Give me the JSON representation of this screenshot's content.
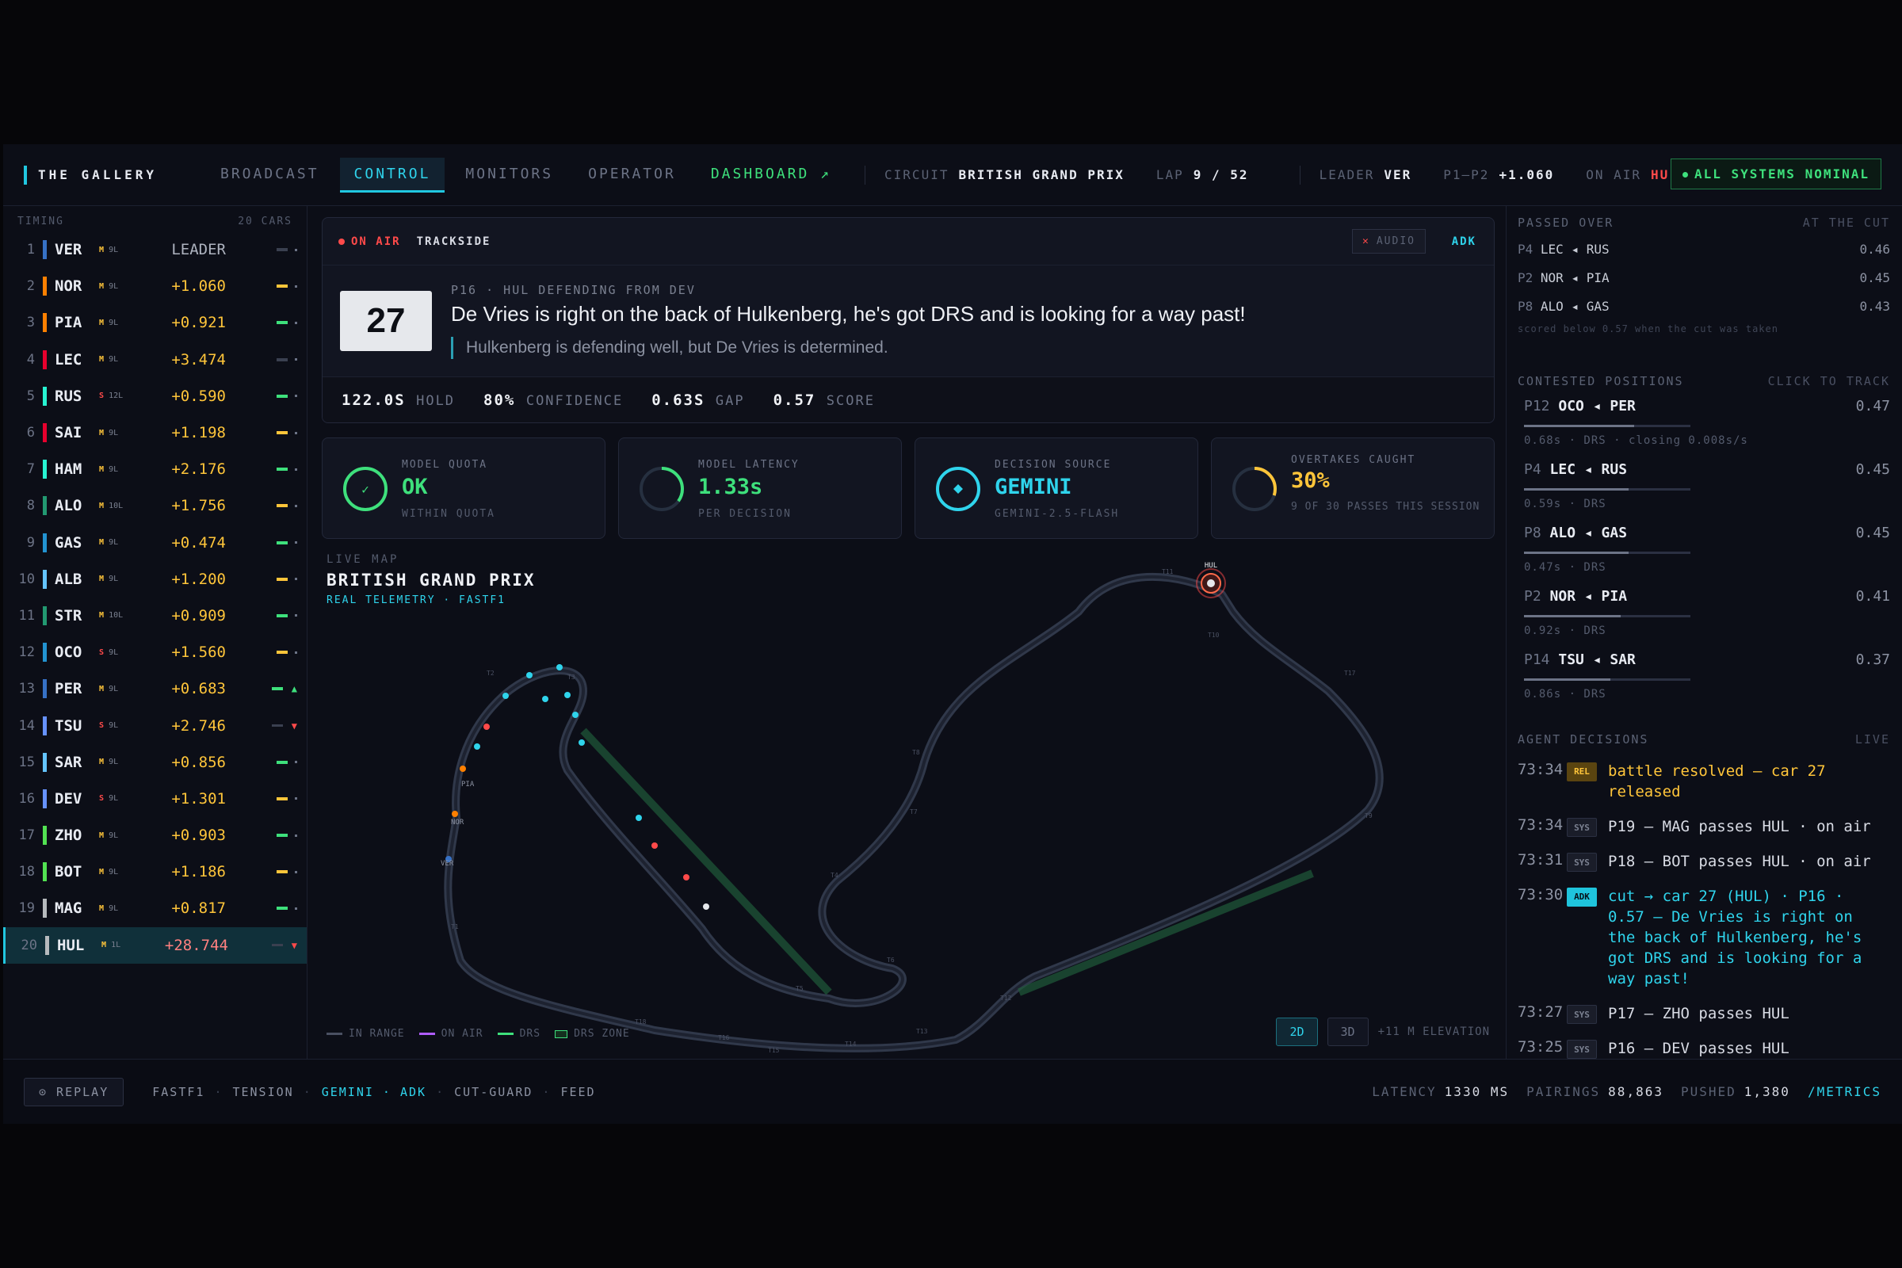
{
  "header": {
    "brand": "THE GALLERY",
    "tabs": [
      "BROADCAST",
      "CONTROL",
      "MONITORS",
      "OPERATOR",
      "DASHBOARD ↗"
    ],
    "circuit_label": "CIRCUIT",
    "circuit": "BRITISH GRAND PRIX",
    "lap_label": "LAP",
    "lap": "9 / 52",
    "leader_label": "LEADER",
    "leader": "VER",
    "p1p2_label": "P1–P2",
    "p1p2": "+1.060",
    "onair_label": "ON AIR",
    "onair": "HUL",
    "status": "ALL SYSTEMS NOMINAL"
  },
  "timing": {
    "title": "TIMING",
    "count": "20 CARS",
    "rows": [
      {
        "pos": "1",
        "code": "VER",
        "tyre": "M",
        "laps": "9L",
        "gap": "LEADER",
        "color": "#3671c6"
      },
      {
        "pos": "2",
        "code": "NOR",
        "tyre": "M",
        "laps": "9L",
        "gap": "+1.060",
        "color": "#ff8000"
      },
      {
        "pos": "3",
        "code": "PIA",
        "tyre": "M",
        "laps": "9L",
        "gap": "+0.921",
        "color": "#ff8000"
      },
      {
        "pos": "4",
        "code": "LEC",
        "tyre": "M",
        "laps": "9L",
        "gap": "+3.474",
        "color": "#e8002d"
      },
      {
        "pos": "5",
        "code": "RUS",
        "tyre": "S",
        "laps": "12L",
        "gap": "+0.590",
        "color": "#27f4d2"
      },
      {
        "pos": "6",
        "code": "SAI",
        "tyre": "M",
        "laps": "9L",
        "gap": "+1.198",
        "color": "#e8002d"
      },
      {
        "pos": "7",
        "code": "HAM",
        "tyre": "M",
        "laps": "9L",
        "gap": "+2.176",
        "color": "#27f4d2"
      },
      {
        "pos": "8",
        "code": "ALO",
        "tyre": "M",
        "laps": "10L",
        "gap": "+1.756",
        "color": "#229971"
      },
      {
        "pos": "9",
        "code": "GAS",
        "tyre": "M",
        "laps": "9L",
        "gap": "+0.474",
        "color": "#2293d1"
      },
      {
        "pos": "10",
        "code": "ALB",
        "tyre": "M",
        "laps": "9L",
        "gap": "+1.200",
        "color": "#64c4ff"
      },
      {
        "pos": "11",
        "code": "STR",
        "tyre": "M",
        "laps": "10L",
        "gap": "+0.909",
        "color": "#229971"
      },
      {
        "pos": "12",
        "code": "OCO",
        "tyre": "S",
        "laps": "9L",
        "gap": "+1.560",
        "color": "#2293d1"
      },
      {
        "pos": "13",
        "code": "PER",
        "tyre": "M",
        "laps": "9L",
        "gap": "+0.683",
        "color": "#3671c6"
      },
      {
        "pos": "14",
        "code": "TSU",
        "tyre": "S",
        "laps": "9L",
        "gap": "+2.746",
        "color": "#6692ff"
      },
      {
        "pos": "15",
        "code": "SAR",
        "tyre": "M",
        "laps": "9L",
        "gap": "+0.856",
        "color": "#64c4ff"
      },
      {
        "pos": "16",
        "code": "DEV",
        "tyre": "S",
        "laps": "9L",
        "gap": "+1.301",
        "color": "#6692ff"
      },
      {
        "pos": "17",
        "code": "ZHO",
        "tyre": "M",
        "laps": "9L",
        "gap": "+0.903",
        "color": "#52e252"
      },
      {
        "pos": "18",
        "code": "BOT",
        "tyre": "M",
        "laps": "9L",
        "gap": "+1.186",
        "color": "#52e252"
      },
      {
        "pos": "19",
        "code": "MAG",
        "tyre": "M",
        "laps": "9L",
        "gap": "+0.817",
        "color": "#b6babd"
      },
      {
        "pos": "20",
        "code": "HUL",
        "tyre": "M",
        "laps": "1L",
        "gap": "+28.744",
        "color": "#b6babd"
      }
    ]
  },
  "onair_card": {
    "tag": "ON AIR",
    "source": "TRACKSIDE",
    "audio": "AUDIO",
    "agent": "ADK",
    "car_number": "27",
    "subtitle": "P16 · HUL DEFENDING FROM DEV",
    "headline": "De Vries is right on the back of Hulkenberg, he's got DRS and is looking for a way past!",
    "quote": "Hulkenberg is defending well, but De Vries is determined.",
    "stats": [
      {
        "value": "122.0S",
        "label": "HOLD"
      },
      {
        "value": "80%",
        "label": "CONFIDENCE"
      },
      {
        "value": "0.63S",
        "label": "GAP"
      },
      {
        "value": "0.57",
        "label": "SCORE"
      }
    ]
  },
  "metrics": [
    {
      "label": "MODEL QUOTA",
      "value": "OK",
      "sub": "WITHIN QUOTA",
      "color": "#3ee07c",
      "fill": 1.0
    },
    {
      "label": "MODEL LATENCY",
      "value": "1.33s",
      "sub": "PER DECISION",
      "color": "#3ee07c",
      "fill": 0.35
    },
    {
      "label": "DECISION SOURCE",
      "value": "GEMINI",
      "sub": "GEMINI-2.5-FLASH",
      "color": "#2fd4ec",
      "fill": 1.0
    },
    {
      "label": "OVERTAKES CAUGHT",
      "value": "30%",
      "sub": "9 OF 30 PASSES THIS SESSION",
      "color": "#ffc53a",
      "fill": 0.3
    }
  ],
  "map": {
    "label": "LIVE MAP",
    "title": "BRITISH GRAND PRIX",
    "subtitle": "REAL TELEMETRY · FASTF1",
    "legend": [
      "IN RANGE",
      "ON AIR",
      "DRS",
      "DRS ZONE"
    ],
    "view_2d": "2D",
    "view_3d": "3D",
    "elevation": "+11 M ELEVATION",
    "car_labels": [
      "HUL",
      "PIA",
      "NOR",
      "VER"
    ],
    "turn_labels": [
      "T1",
      "T2",
      "T3",
      "T4",
      "T5",
      "T6",
      "T7",
      "T8",
      "T9",
      "T10",
      "T11",
      "T12",
      "T13",
      "T14",
      "T15",
      "T16",
      "T17",
      "T18"
    ]
  },
  "passed_over": {
    "title": "PASSED OVER",
    "right": "AT THE CUT",
    "rows": [
      {
        "pos": "P4",
        "pair": "LEC ◂ RUS",
        "score": "0.46"
      },
      {
        "pos": "P2",
        "pair": "NOR ◂ PIA",
        "score": "0.45"
      },
      {
        "pos": "P8",
        "pair": "ALO ◂ GAS",
        "score": "0.43"
      }
    ],
    "note": "scored below 0.57 when the cut was taken"
  },
  "contested": {
    "title": "CONTESTED POSITIONS",
    "right": "CLICK TO TRACK",
    "rows": [
      {
        "pos": "P12",
        "pair": "OCO ◂ PER",
        "score": "0.47",
        "meta": "0.68s · DRS · closing 0.008s/s",
        "fill": 0.66
      },
      {
        "pos": "P4",
        "pair": "LEC ◂ RUS",
        "score": "0.45",
        "meta": "0.59s · DRS",
        "fill": 0.63
      },
      {
        "pos": "P8",
        "pair": "ALO ◂ GAS",
        "score": "0.45",
        "meta": "0.47s · DRS",
        "fill": 0.63
      },
      {
        "pos": "P2",
        "pair": "NOR ◂ PIA",
        "score": "0.41",
        "meta": "0.92s · DRS",
        "fill": 0.58
      },
      {
        "pos": "P14",
        "pair": "TSU ◂ SAR",
        "score": "0.37",
        "meta": "0.86s · DRS",
        "fill": 0.52
      }
    ]
  },
  "decisions": {
    "title": "AGENT DECISIONS",
    "right": "LIVE",
    "rows": [
      {
        "time": "73:34",
        "badge": "REL",
        "text": "battle resolved — car 27 released",
        "kind": "rel"
      },
      {
        "time": "73:34",
        "badge": "SYS",
        "text": "P19 — MAG passes HUL · on air",
        "kind": "sys"
      },
      {
        "time": "73:31",
        "badge": "SYS",
        "text": "P18 — BOT passes HUL · on air",
        "kind": "sys"
      },
      {
        "time": "73:30",
        "badge": "ADK",
        "text": "cut → car 27 (HUL) · P16 · 0.57 — De Vries is right on the back of Hulkenberg, he's got DRS and is looking for a way past!",
        "kind": "adk"
      },
      {
        "time": "73:27",
        "badge": "SYS",
        "text": "P17 — ZHO passes HUL",
        "kind": "sys"
      },
      {
        "time": "73:25",
        "badge": "SYS",
        "text": "P16 — DEV passes HUL",
        "kind": "sys"
      }
    ]
  },
  "footer": {
    "replay": "⊙ REPLAY",
    "items": [
      "FASTF1",
      "TENSION",
      "GEMINI · ADK",
      "CUT-GUARD",
      "FEED"
    ],
    "latency_label": "LATENCY",
    "latency": "1330 MS",
    "pairings_label": "PAIRINGS",
    "pairings": "88,863",
    "pushed_label": "PUSHED",
    "pushed": "1,380",
    "metrics_link": "/METRICS"
  },
  "colors": {
    "accent": "#21c7e0",
    "green": "#3ee07c",
    "amber": "#ffc53a",
    "red": "#ff4a4a"
  }
}
